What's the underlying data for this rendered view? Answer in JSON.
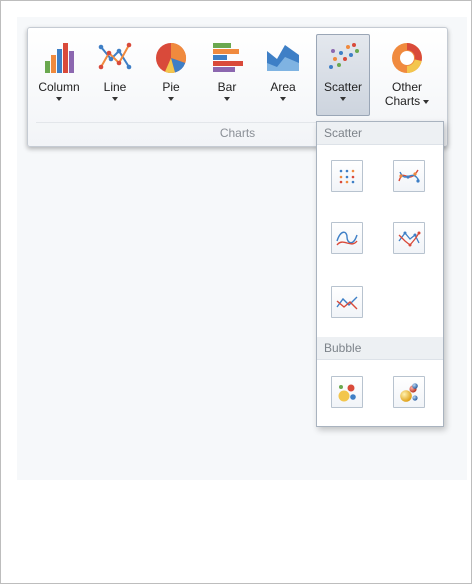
{
  "ribbon": {
    "group_label": "Charts",
    "buttons": [
      {
        "label": "Column",
        "icon": "column-chart-icon"
      },
      {
        "label": "Line",
        "icon": "line-chart-icon"
      },
      {
        "label": "Pie",
        "icon": "pie-chart-icon"
      },
      {
        "label": "Bar",
        "icon": "bar-chart-icon"
      },
      {
        "label": "Area",
        "icon": "area-chart-icon"
      },
      {
        "label": "Scatter",
        "icon": "scatter-chart-icon",
        "active": true
      },
      {
        "label_line1": "Other",
        "label_line2": "Charts",
        "icon": "doughnut-chart-icon"
      }
    ]
  },
  "dropdown": {
    "sections": [
      {
        "header": "Scatter",
        "items": [
          {
            "icon": "scatter-point-icon"
          },
          {
            "icon": "scatter-smooth-markers-icon"
          },
          {
            "icon": "scatter-smooth-line-icon"
          },
          {
            "icon": "scatter-line-markers-icon"
          },
          {
            "icon": "scatter-line-icon"
          }
        ]
      },
      {
        "header": "Bubble",
        "items": [
          {
            "icon": "bubble-icon"
          },
          {
            "icon": "bubble-3d-icon"
          }
        ]
      }
    ]
  },
  "colors": {
    "blue": "#3e7fc6",
    "orange": "#f08a3e",
    "red": "#d94a3a",
    "green": "#6aa84f",
    "purple": "#8c67b0",
    "teal": "#4fb0c6"
  }
}
